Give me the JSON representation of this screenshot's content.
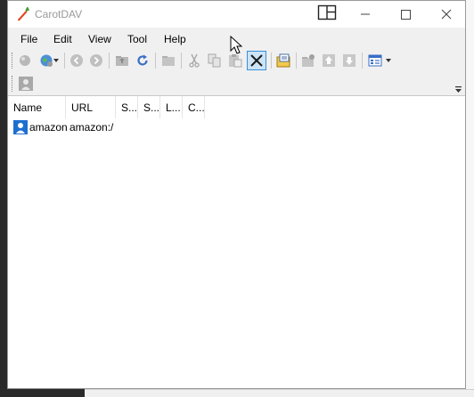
{
  "window": {
    "title": "CarotDAV"
  },
  "menu": {
    "items": [
      "File",
      "Edit",
      "View",
      "Tool",
      "Help"
    ]
  },
  "list": {
    "columns": [
      "Name",
      "URL",
      "S...",
      "S...",
      "L...",
      "C..."
    ],
    "rows": [
      {
        "name": "amazon",
        "url": "amazon:/"
      }
    ]
  },
  "colors": {
    "accent": "#3c8fd6",
    "menubar": "#f0f0f0",
    "window": "#ffffff"
  }
}
